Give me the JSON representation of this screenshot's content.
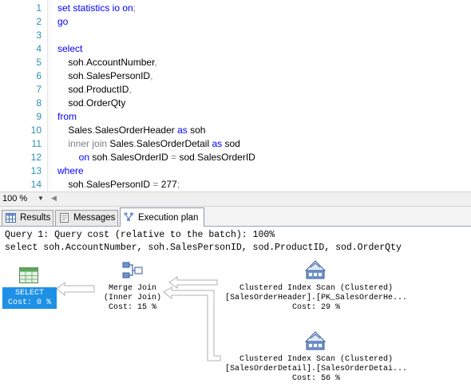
{
  "editor": {
    "lines": [
      {
        "n": "1",
        "parts": [
          {
            "t": "set statistics io ",
            "c": "kw"
          },
          {
            "t": "on",
            "c": "kw"
          },
          {
            "t": ";",
            "c": "gr"
          }
        ]
      },
      {
        "n": "2",
        "parts": [
          {
            "t": "go",
            "c": "kw"
          }
        ]
      },
      {
        "n": "3",
        "parts": []
      },
      {
        "n": "4",
        "parts": [
          {
            "t": "select",
            "c": "kw"
          }
        ]
      },
      {
        "n": "5",
        "parts": [
          {
            "t": "    soh",
            "c": "tx"
          },
          {
            "t": ".",
            "c": "gr"
          },
          {
            "t": "AccountNumber",
            "c": "tx"
          },
          {
            "t": ",",
            "c": "gr"
          }
        ]
      },
      {
        "n": "6",
        "parts": [
          {
            "t": "    soh",
            "c": "tx"
          },
          {
            "t": ".",
            "c": "gr"
          },
          {
            "t": "SalesPersonID",
            "c": "tx"
          },
          {
            "t": ",",
            "c": "gr"
          }
        ]
      },
      {
        "n": "7",
        "parts": [
          {
            "t": "    sod",
            "c": "tx"
          },
          {
            "t": ".",
            "c": "gr"
          },
          {
            "t": "ProductID",
            "c": "tx"
          },
          {
            "t": ",",
            "c": "gr"
          }
        ]
      },
      {
        "n": "8",
        "parts": [
          {
            "t": "    sod",
            "c": "tx"
          },
          {
            "t": ".",
            "c": "gr"
          },
          {
            "t": "OrderQty",
            "c": "tx"
          }
        ]
      },
      {
        "n": "9",
        "parts": [
          {
            "t": "from",
            "c": "kw"
          }
        ]
      },
      {
        "n": "10",
        "parts": [
          {
            "t": "    Sales",
            "c": "tx"
          },
          {
            "t": ".",
            "c": "gr"
          },
          {
            "t": "SalesOrderHeader ",
            "c": "tx"
          },
          {
            "t": "as",
            "c": "kw"
          },
          {
            "t": " soh",
            "c": "tx"
          }
        ]
      },
      {
        "n": "11",
        "parts": [
          {
            "t": "    inner join ",
            "c": "gr"
          },
          {
            "t": "Sales",
            "c": "tx"
          },
          {
            "t": ".",
            "c": "gr"
          },
          {
            "t": "SalesOrderDetail ",
            "c": "tx"
          },
          {
            "t": "as",
            "c": "kw"
          },
          {
            "t": " sod",
            "c": "tx"
          }
        ]
      },
      {
        "n": "12",
        "parts": [
          {
            "t": "        on",
            "c": "kw"
          },
          {
            "t": " soh",
            "c": "tx"
          },
          {
            "t": ".",
            "c": "gr"
          },
          {
            "t": "SalesOrderID ",
            "c": "tx"
          },
          {
            "t": "=",
            "c": "gr"
          },
          {
            "t": " sod",
            "c": "tx"
          },
          {
            "t": ".",
            "c": "gr"
          },
          {
            "t": "SalesOrderID",
            "c": "tx"
          }
        ]
      },
      {
        "n": "13",
        "parts": [
          {
            "t": "where",
            "c": "kw"
          }
        ]
      },
      {
        "n": "14",
        "parts": [
          {
            "t": "    soh",
            "c": "tx"
          },
          {
            "t": ".",
            "c": "gr"
          },
          {
            "t": "SalesPersonID ",
            "c": "tx"
          },
          {
            "t": "=",
            "c": "gr"
          },
          {
            "t": " 277",
            "c": "tx"
          },
          {
            "t": ";",
            "c": "gr"
          }
        ]
      }
    ]
  },
  "zoom": {
    "level": "100 %"
  },
  "tabs": [
    {
      "label": "Results",
      "icon": "grid-icon",
      "active": false
    },
    {
      "label": "Messages",
      "icon": "messages-icon",
      "active": false
    },
    {
      "label": "Execution plan",
      "icon": "execution-plan-icon",
      "active": true
    }
  ],
  "plan": {
    "query_header": "Query 1: Query cost (relative to the batch): 100%",
    "query_text": "select soh.AccountNumber, soh.SalesPersonID, sod.ProductID, sod.OrderQty",
    "select_op": {
      "name": "SELECT",
      "cost": "Cost: 0 %",
      "icon": "select-icon"
    },
    "merge_join": {
      "name": "Merge Join",
      "detail": "(Inner Join)",
      "cost": "Cost: 15 %",
      "icon": "merge-join-icon"
    },
    "scan_header": {
      "name": "Clustered Index Scan (Clustered)",
      "object": "[SalesOrderHeader].[PK_SalesOrderHe...",
      "cost": "Cost: 29 %",
      "icon": "clustered-index-scan-icon"
    },
    "scan_detail": {
      "name": "Clustered Index Scan (Clustered)",
      "object": "[SalesOrderDetail].[SalesOrderDetai...",
      "cost": "Cost: 56 %",
      "icon": "clustered-index-scan-icon"
    },
    "colors": {
      "selected": "#1e90e6",
      "arrow_fill": "#ffffff",
      "arrow_stroke": "#b0b0b0"
    }
  }
}
